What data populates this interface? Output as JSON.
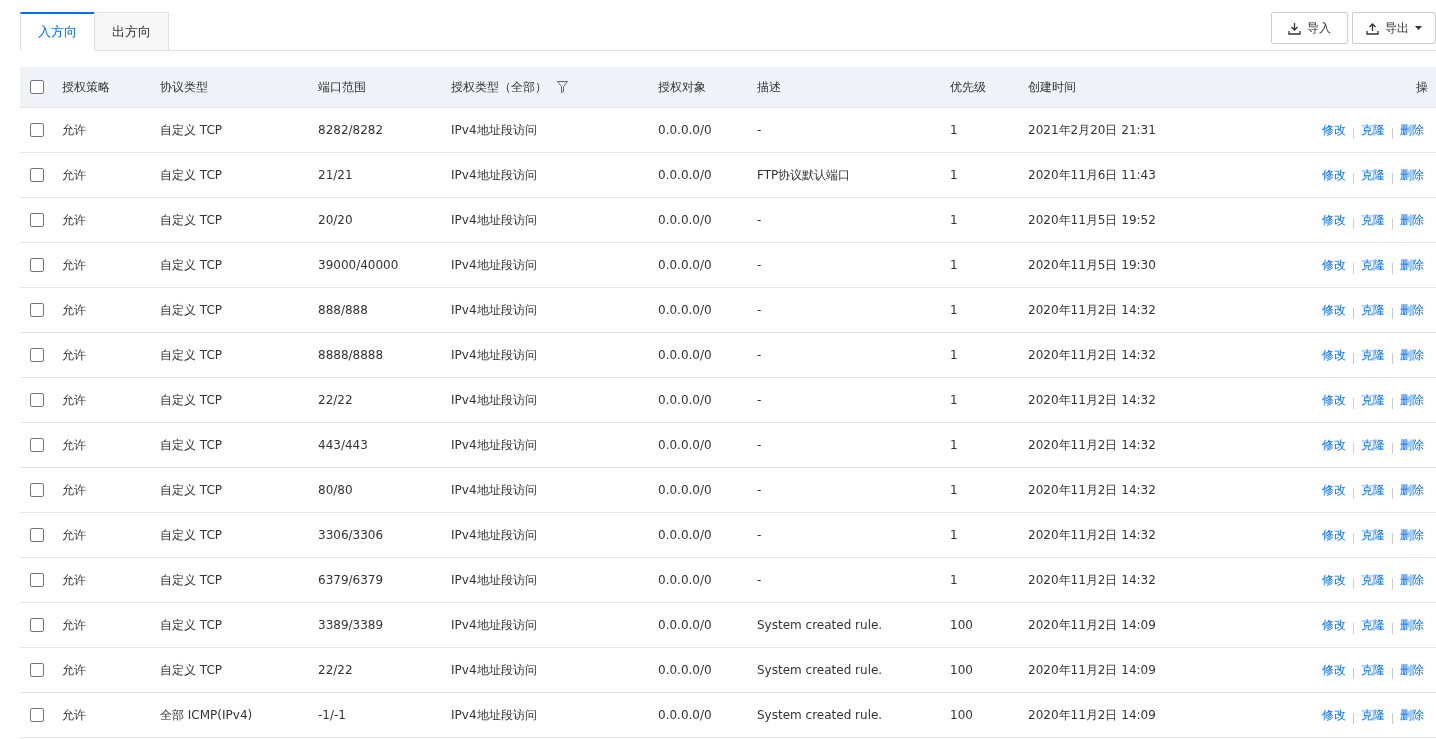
{
  "tabs": [
    {
      "label": "入方向",
      "selected": true
    },
    {
      "label": "出方向",
      "selected": false
    }
  ],
  "toolbar": {
    "buttons": [
      {
        "label": "导入",
        "kind": "import"
      },
      {
        "label": "导出",
        "kind": "export"
      }
    ]
  },
  "table": {
    "select_all": {
      "checked": false
    },
    "columns": [
      "授权策略",
      "协议类型",
      "端口范围",
      "授权类型（全部）",
      "授权对象",
      "描述",
      "优先级",
      "创建时间",
      "操"
    ],
    "rows": [
      {
        "checked": false,
        "cells": [
          "允许",
          "自定义 TCP",
          "8282/8282",
          "IPv4地址段访问",
          "0.0.0.0/0",
          "-",
          "1",
          "2021年2月20日 21:31"
        ],
        "actions": [
          "修改",
          "克隆",
          "删除"
        ]
      },
      {
        "checked": false,
        "cells": [
          "允许",
          "自定义 TCP",
          "21/21",
          "IPv4地址段访问",
          "0.0.0.0/0",
          "FTP协议默认端口",
          "1",
          "2020年11月6日 11:43"
        ],
        "actions": [
          "修改",
          "克隆",
          "删除"
        ]
      },
      {
        "checked": false,
        "cells": [
          "允许",
          "自定义 TCP",
          "20/20",
          "IPv4地址段访问",
          "0.0.0.0/0",
          "-",
          "1",
          "2020年11月5日 19:52"
        ],
        "actions": [
          "修改",
          "克隆",
          "删除"
        ]
      },
      {
        "checked": false,
        "cells": [
          "允许",
          "自定义 TCP",
          "39000/40000",
          "IPv4地址段访问",
          "0.0.0.0/0",
          "-",
          "1",
          "2020年11月5日 19:30"
        ],
        "actions": [
          "修改",
          "克隆",
          "删除"
        ]
      },
      {
        "checked": false,
        "cells": [
          "允许",
          "自定义 TCP",
          "888/888",
          "IPv4地址段访问",
          "0.0.0.0/0",
          "-",
          "1",
          "2020年11月2日 14:32"
        ],
        "actions": [
          "修改",
          "克隆",
          "删除"
        ]
      },
      {
        "checked": false,
        "cells": [
          "允许",
          "自定义 TCP",
          "8888/8888",
          "IPv4地址段访问",
          "0.0.0.0/0",
          "-",
          "1",
          "2020年11月2日 14:32"
        ],
        "actions": [
          "修改",
          "克隆",
          "删除"
        ]
      },
      {
        "checked": false,
        "cells": [
          "允许",
          "自定义 TCP",
          "22/22",
          "IPv4地址段访问",
          "0.0.0.0/0",
          "-",
          "1",
          "2020年11月2日 14:32"
        ],
        "actions": [
          "修改",
          "克隆",
          "删除"
        ]
      },
      {
        "checked": false,
        "cells": [
          "允许",
          "自定义 TCP",
          "443/443",
          "IPv4地址段访问",
          "0.0.0.0/0",
          "-",
          "1",
          "2020年11月2日 14:32"
        ],
        "actions": [
          "修改",
          "克隆",
          "删除"
        ]
      },
      {
        "checked": false,
        "cells": [
          "允许",
          "自定义 TCP",
          "80/80",
          "IPv4地址段访问",
          "0.0.0.0/0",
          "-",
          "1",
          "2020年11月2日 14:32"
        ],
        "actions": [
          "修改",
          "克隆",
          "删除"
        ]
      },
      {
        "checked": false,
        "cells": [
          "允许",
          "自定义 TCP",
          "3306/3306",
          "IPv4地址段访问",
          "0.0.0.0/0",
          "-",
          "1",
          "2020年11月2日 14:32"
        ],
        "actions": [
          "修改",
          "克隆",
          "删除"
        ]
      },
      {
        "checked": false,
        "cells": [
          "允许",
          "自定义 TCP",
          "6379/6379",
          "IPv4地址段访问",
          "0.0.0.0/0",
          "-",
          "1",
          "2020年11月2日 14:32"
        ],
        "actions": [
          "修改",
          "克隆",
          "删除"
        ]
      },
      {
        "checked": false,
        "cells": [
          "允许",
          "自定义 TCP",
          "3389/3389",
          "IPv4地址段访问",
          "0.0.0.0/0",
          "System created rule.",
          "100",
          "2020年11月2日 14:09"
        ],
        "actions": [
          "修改",
          "克隆",
          "删除"
        ]
      },
      {
        "checked": false,
        "cells": [
          "允许",
          "自定义 TCP",
          "22/22",
          "IPv4地址段访问",
          "0.0.0.0/0",
          "System created rule.",
          "100",
          "2020年11月2日 14:09"
        ],
        "actions": [
          "修改",
          "克隆",
          "删除"
        ]
      },
      {
        "checked": false,
        "cells": [
          "允许",
          "全部 ICMP(IPv4)",
          "-1/-1",
          "IPv4地址段访问",
          "0.0.0.0/0",
          "System created rule.",
          "100",
          "2020年11月2日 14:09"
        ],
        "actions": [
          "修改",
          "克隆",
          "删除"
        ]
      }
    ]
  }
}
